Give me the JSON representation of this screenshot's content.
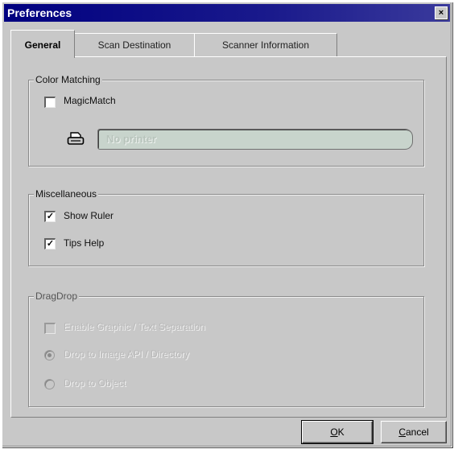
{
  "window": {
    "title": "Preferences",
    "close_glyph": "×"
  },
  "tabs": [
    {
      "label": "General",
      "active": true
    },
    {
      "label": "Scan Destination",
      "active": false
    },
    {
      "label": "Scanner Information",
      "active": false
    }
  ],
  "color_matching": {
    "title": "Color Matching",
    "magicmatch_label": "MagicMatch",
    "magicmatch_checked": false,
    "printer_icon": "printer-icon",
    "printer_value": "No printer"
  },
  "miscellaneous": {
    "title": "Miscellaneous",
    "show_ruler_label": "Show Ruler",
    "show_ruler_checked": true,
    "tips_help_label": "Tips Help",
    "tips_help_checked": true,
    "check_glyph": "✓"
  },
  "dragdrop": {
    "title": "DragDrop",
    "enable_label": "Enable Graphic / Text Separation",
    "option1_label": "Drop to Image API / Directory",
    "option2_label": "Drop to Object",
    "enabled": false
  },
  "buttons": {
    "ok_mnemonic": "O",
    "ok_rest": "K",
    "cancel_mnemonic": "C",
    "cancel_rest": "ancel"
  },
  "colors": {
    "titlebar": "#000080",
    "face": "#c8c8c8",
    "printer_field": "#c8d4cc"
  }
}
